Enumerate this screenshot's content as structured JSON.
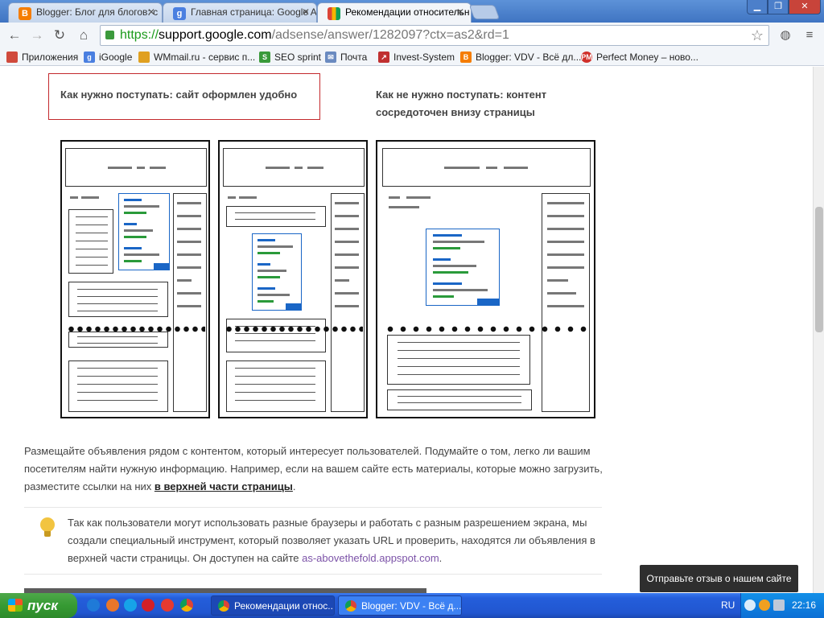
{
  "tabs": [
    {
      "title": "Blogger: Блог для блогов: с",
      "icon": "blogger-icon"
    },
    {
      "title": "Главная страница: Google A",
      "icon": "google-icon"
    },
    {
      "title": "Рекомендации относительн",
      "icon": "google-help-icon",
      "active": true
    }
  ],
  "window_controls": {
    "minimize": "▁",
    "maximize": "❐",
    "close": "✕"
  },
  "toolbar": {
    "back": "←",
    "forward": "→",
    "reload": "↻",
    "home": "⌂",
    "url_scheme": "https://",
    "url_host": "support.google.com",
    "url_path": "/adsense/answer/1282097?ctx=as2&rd=1"
  },
  "bookmarks": [
    {
      "label": "Приложения",
      "icon": "apps-icon",
      "color": "#d04a3c"
    },
    {
      "label": "iGoogle",
      "icon": "google-icon",
      "color": "#4a7fe0"
    },
    {
      "label": "WMmail.ru - сервис п...",
      "icon": "wmmail-icon",
      "color": "#e0a020"
    },
    {
      "label": "SEO sprint",
      "icon": "seosprint-icon",
      "color": "#3a9a3a"
    },
    {
      "label": "Почта",
      "icon": "mail-icon",
      "color": "#6a8ac0"
    },
    {
      "label": "Invest-System",
      "icon": "invest-icon",
      "color": "#c03030"
    },
    {
      "label": "Blogger: VDV - Всё дл...",
      "icon": "blogger-icon",
      "color": "#f57d00"
    },
    {
      "label": "Perfect Money – ново...",
      "icon": "perfectmoney-icon",
      "color": "#d0302a"
    }
  ],
  "content": {
    "good_caption": "Как нужно поступать: сайт оформлен удобно",
    "bad_caption_1": "Как не нужно поступать: контент",
    "bad_caption_2": "сосредоточен внизу страницы",
    "para_text": "Размещайте объявления рядом с контентом, который интересует пользователей. Подумайте о том, легко ли вашим посетителям найти нужную информацию. Например, если на вашем сайте есть материалы, которые можно загрузить, разместите ссылки на них ",
    "para_link": "в верхней части страницы",
    "para_end": ".",
    "note_text": "Так как пользователи могут использовать разные браузеры и работать с разным разрешением экрана, мы создали специальный инструмент, который позволяет указать URL и проверить, находятся ли объявления в верхней части страницы. Он доступен на сайте ",
    "note_link": "as-abovethefold.appspot.com",
    "note_end": ".",
    "feedback": "Отправьте отзыв о нашем сайте"
  },
  "taskbar": {
    "start": "пуск",
    "tasks": [
      {
        "label": "Рекомендации относ...",
        "active": true
      },
      {
        "label": "Blogger: VDV - Всё д...",
        "active": false
      }
    ],
    "lang": "RU",
    "clock": "22:16"
  }
}
